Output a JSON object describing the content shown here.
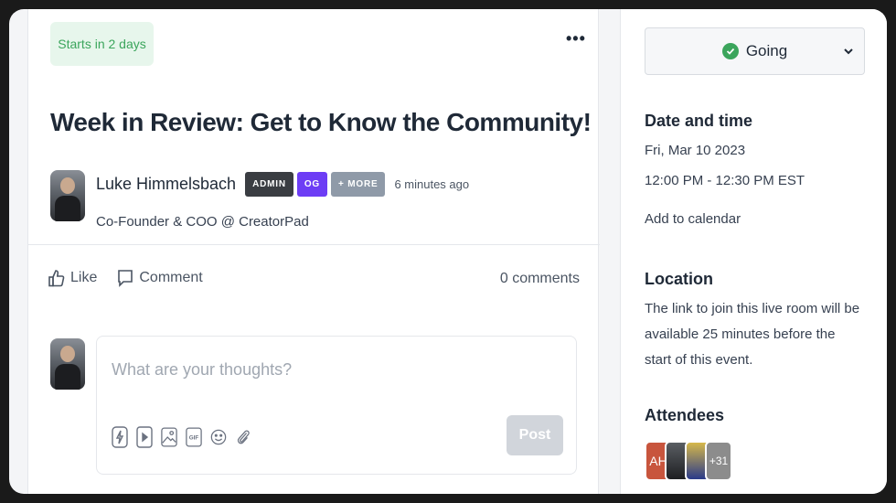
{
  "event": {
    "start_badge": "Starts in 2 days",
    "more_icon": "•••",
    "title": "Week in Review: Get to Know the Community!"
  },
  "author": {
    "name": "Luke Himmelsbach",
    "tags": [
      "ADMIN",
      "OG",
      "+ MORE"
    ],
    "time": "6 minutes ago",
    "role": "Co-Founder & COO @ CreatorPad"
  },
  "actions": {
    "like_label": "Like",
    "comment_label": "Comment",
    "comments_count": "0 comments"
  },
  "composer": {
    "placeholder": "What are your thoughts?",
    "post_label": "Post",
    "tools": [
      "bolt-icon",
      "video-icon",
      "image-icon",
      "gif-icon",
      "emoji-icon",
      "attach-icon"
    ]
  },
  "sidebar": {
    "rsvp_label": "Going",
    "date_heading": "Date and time",
    "date": "Fri, Mar 10 2023",
    "time": "12:00 PM - 12:30 PM EST",
    "add_calendar": "Add to calendar",
    "location_heading": "Location",
    "location_text": "The link to join this live room will be available 25 minutes before the start of this event.",
    "attendees_heading": "Attendees",
    "attendees": [
      "AH",
      "+31"
    ]
  },
  "colors": {
    "accent_green": "#3ba55c",
    "og_purple": "#6d3df5",
    "admin_dark": "#3a3d42"
  }
}
